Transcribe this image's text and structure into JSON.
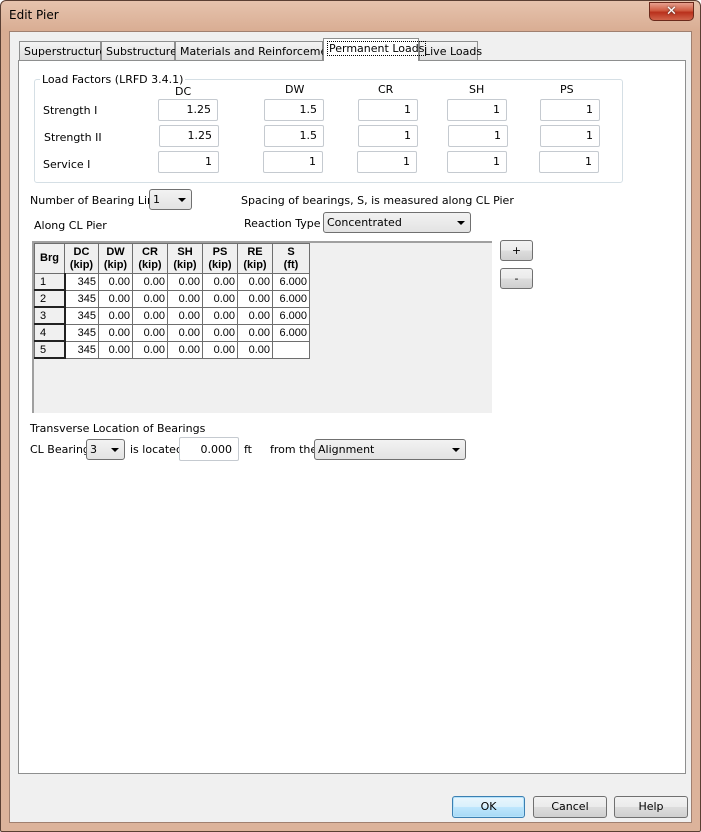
{
  "window": {
    "title": "Edit Pier",
    "close_glyph": "✕"
  },
  "tabs": [
    {
      "label": "Superstructure",
      "active": false
    },
    {
      "label": "Substructure",
      "active": false
    },
    {
      "label": "Materials and Reinforcement",
      "active": false
    },
    {
      "label": "Permanent Loads",
      "active": true
    },
    {
      "label": "Live Loads",
      "active": false
    }
  ],
  "load_factors": {
    "legend": "Load Factors (LRFD 3.4.1)",
    "columns": [
      "DC",
      "DW",
      "CR",
      "SH",
      "PS"
    ],
    "rows": [
      {
        "label": "Strength I",
        "values": [
          "1.25",
          "1.5",
          "1",
          "1",
          "1"
        ]
      },
      {
        "label": "Strength II",
        "values": [
          "1.25",
          "1.5",
          "1",
          "1",
          "1"
        ]
      },
      {
        "label": "Service I",
        "values": [
          "1",
          "1",
          "1",
          "1",
          "1"
        ]
      }
    ]
  },
  "bearing": {
    "num_lines_label": "Number of Bearing Lines",
    "num_lines_value": "1",
    "spacing_note": "Spacing of bearings, S, is measured along CL Pier",
    "along_label": "Along CL Pier",
    "reaction_type_label": "Reaction Type",
    "reaction_type_value": "Concentrated",
    "add_button": "+",
    "remove_button": "-"
  },
  "grid": {
    "headers": [
      [
        "Brg",
        ""
      ],
      [
        "DC",
        "(kip)"
      ],
      [
        "DW",
        "(kip)"
      ],
      [
        "CR",
        "(kip)"
      ],
      [
        "SH",
        "(kip)"
      ],
      [
        "PS",
        "(kip)"
      ],
      [
        "RE",
        "(kip)"
      ],
      [
        "S",
        "(ft)"
      ]
    ],
    "rows": [
      [
        "1",
        "345",
        "0.00",
        "0.00",
        "0.00",
        "0.00",
        "0.00",
        "6.000"
      ],
      [
        "2",
        "345",
        "0.00",
        "0.00",
        "0.00",
        "0.00",
        "0.00",
        "6.000"
      ],
      [
        "3",
        "345",
        "0.00",
        "0.00",
        "0.00",
        "0.00",
        "0.00",
        "6.000"
      ],
      [
        "4",
        "345",
        "0.00",
        "0.00",
        "0.00",
        "0.00",
        "0.00",
        "6.000"
      ],
      [
        "5",
        "345",
        "0.00",
        "0.00",
        "0.00",
        "0.00",
        "0.00",
        ""
      ]
    ]
  },
  "transverse": {
    "heading": "Transverse Location of Bearings",
    "cl_bearing_label": "CL Bearing",
    "cl_bearing_value": "3",
    "is_located_label": "is located",
    "offset_value": "0.000",
    "unit_label": "ft",
    "from_label": "from the",
    "reference_value": "Alignment"
  },
  "footer": {
    "ok": "OK",
    "cancel": "Cancel",
    "help": "Help"
  }
}
